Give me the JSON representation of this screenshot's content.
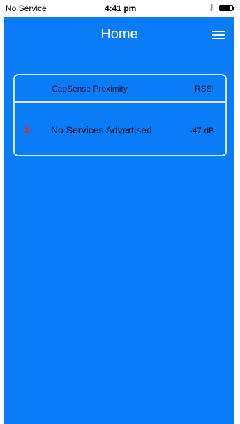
{
  "status_bar": {
    "carrier": "No Service",
    "time": "4:41 pm"
  },
  "nav": {
    "title": "Home",
    "menu_icon": "hamburger-menu-icon"
  },
  "device_list": {
    "header": {
      "name_label": "CapSense Proximity",
      "rssi_label": "RSSI"
    },
    "rows": [
      {
        "icon": "bluetooth-icon",
        "name": "No Services Advertised",
        "rssi": "-47 dB"
      }
    ]
  },
  "colors": {
    "app_background": "#0a7cf7",
    "panel_border": "#d8e8ff",
    "bluetooth_icon": "#d0312d"
  }
}
